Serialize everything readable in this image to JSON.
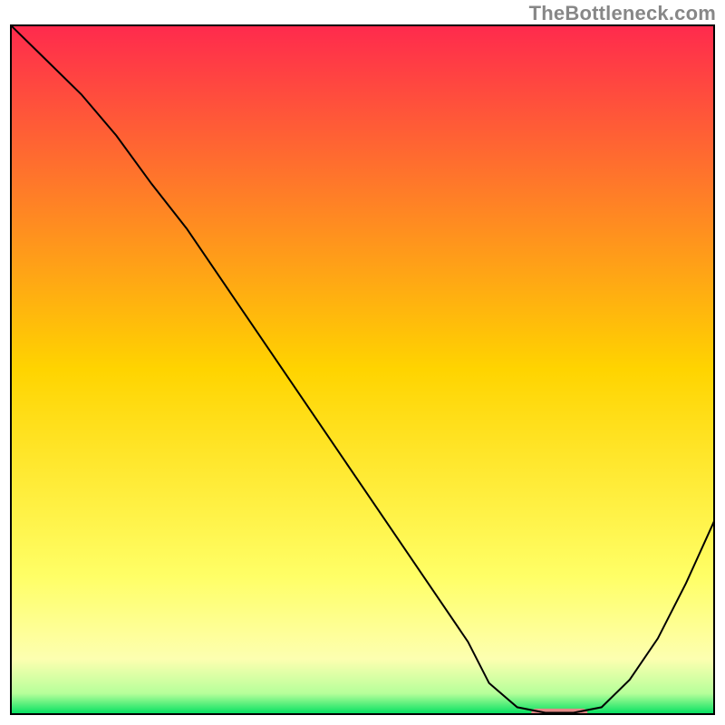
{
  "watermark": "TheBottleneck.com",
  "chart_data": {
    "type": "line",
    "title": "",
    "xlabel": "",
    "ylabel": "",
    "xlim": [
      0,
      100
    ],
    "ylim": [
      0,
      100
    ],
    "grid": false,
    "legend": false,
    "background_gradient": {
      "stops": [
        {
          "offset": 0.0,
          "color": "#ff2a4d"
        },
        {
          "offset": 0.5,
          "color": "#ffd400"
        },
        {
          "offset": 0.8,
          "color": "#ffff66"
        },
        {
          "offset": 0.92,
          "color": "#fdffb0"
        },
        {
          "offset": 0.97,
          "color": "#b6ff9a"
        },
        {
          "offset": 1.0,
          "color": "#00e060"
        }
      ]
    },
    "series": [
      {
        "name": "curve",
        "stroke": "#000000",
        "stroke_width": 2,
        "x": [
          0,
          5,
          10,
          15,
          20,
          25,
          30,
          35,
          40,
          45,
          50,
          55,
          60,
          65,
          68,
          72,
          76,
          80,
          84,
          88,
          92,
          96,
          100
        ],
        "y": [
          100,
          95,
          90,
          84,
          77,
          70.5,
          63,
          55.5,
          48,
          40.5,
          33,
          25.5,
          18,
          10.5,
          4.5,
          1.0,
          0.2,
          0.2,
          1.0,
          5.0,
          11,
          19,
          28
        ]
      }
    ],
    "marker": {
      "name": "optimal-range",
      "shape": "rounded-rect",
      "fill": "#e38a87",
      "x_range": [
        74,
        82
      ],
      "y": 0.2,
      "height_pct": 1.2
    },
    "frame": {
      "stroke": "#000000",
      "stroke_width": 2
    }
  }
}
